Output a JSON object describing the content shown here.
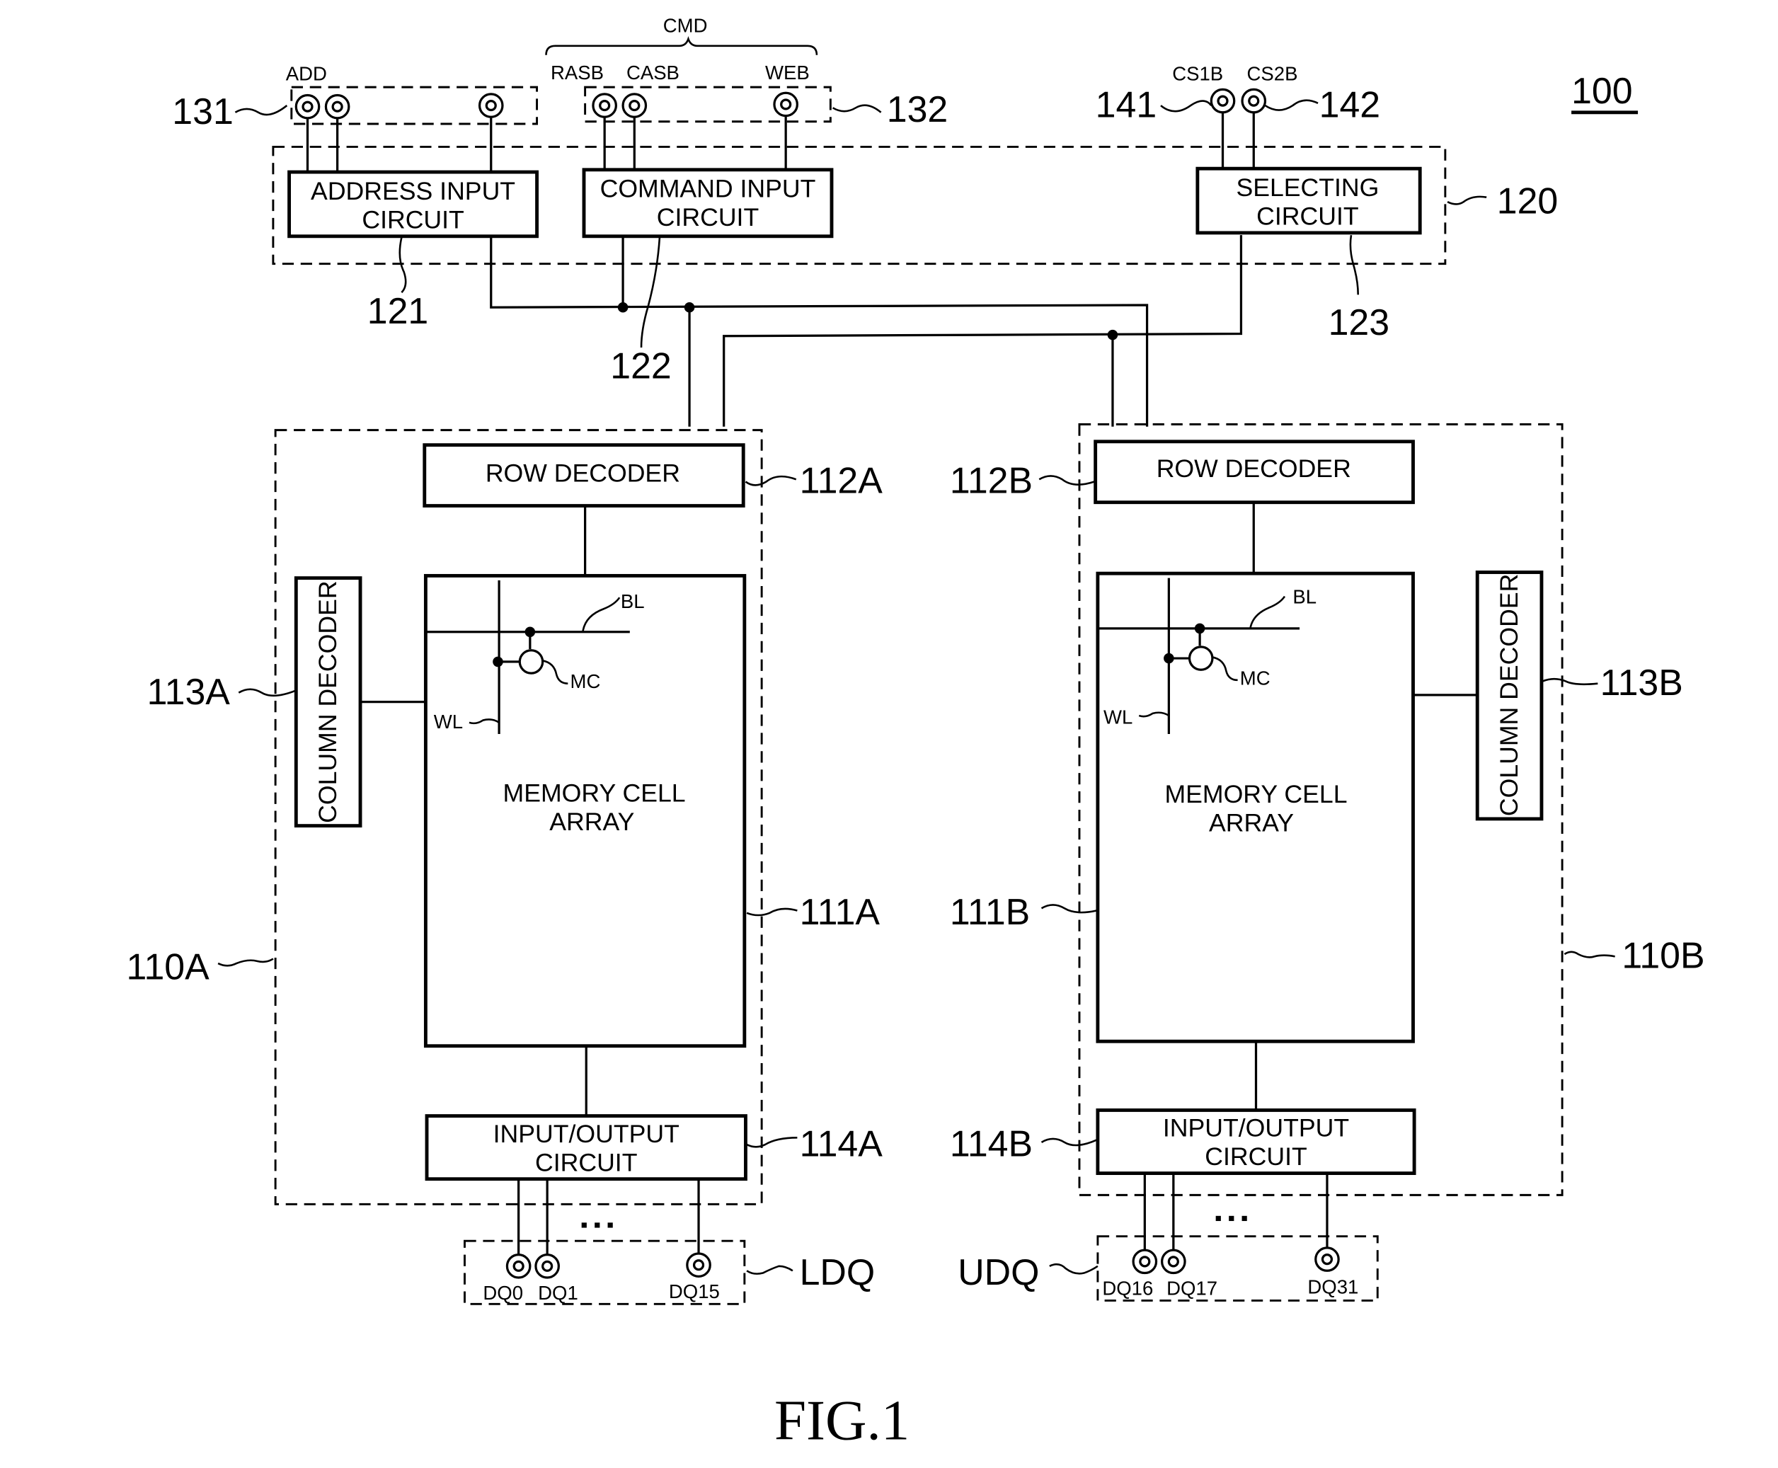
{
  "figure": {
    "reference": "100",
    "caption": "FIG.1"
  },
  "pads": {
    "address_group_ref": "131",
    "address_label": "ADD",
    "command_group_ref": "132",
    "command_bus_label": "CMD",
    "command_signals": [
      "RASB",
      "CASB",
      "WEB"
    ],
    "cs1_ref": "141",
    "cs1_label": "CS1B",
    "cs2_ref": "142",
    "cs2_label": "CS2B"
  },
  "control_block": {
    "ref": "120",
    "address_input": {
      "ref": "121",
      "line1": "ADDRESS INPUT",
      "line2": "CIRCUIT"
    },
    "command_input": {
      "ref": "122",
      "line1": "COMMAND INPUT",
      "line2": "CIRCUIT"
    },
    "selecting": {
      "ref": "123",
      "line1": "SELECTING",
      "line2": "CIRCUIT"
    }
  },
  "bank_a": {
    "ref": "110A",
    "row_decoder": {
      "ref": "112A",
      "label": "ROW DECODER"
    },
    "column_decoder": {
      "ref": "113A",
      "label": "COLUMN DECODER"
    },
    "array": {
      "ref": "111A",
      "line1": "MEMORY CELL",
      "line2": "ARRAY",
      "bl": "BL",
      "wl": "WL",
      "mc": "MC"
    },
    "io": {
      "ref": "114A",
      "line1": "INPUT/OUTPUT",
      "line2": "CIRCUIT"
    },
    "dq_group": {
      "ref": "LDQ",
      "pins": [
        "DQ0",
        "DQ1",
        "DQ15"
      ]
    }
  },
  "bank_b": {
    "ref": "110B",
    "row_decoder": {
      "ref": "112B",
      "label": "ROW DECODER"
    },
    "column_decoder": {
      "ref": "113B",
      "label": "COLUMN DECODER"
    },
    "array": {
      "ref": "111B",
      "line1": "MEMORY CELL",
      "line2": "ARRAY",
      "bl": "BL",
      "wl": "WL",
      "mc": "MC"
    },
    "io": {
      "ref": "114B",
      "line1": "INPUT/OUTPUT",
      "line2": "CIRCUIT"
    },
    "dq_group": {
      "ref": "UDQ",
      "pins": [
        "DQ16",
        "DQ17",
        "DQ31"
      ]
    }
  },
  "ellipsis": "▪ ▪ ▪"
}
